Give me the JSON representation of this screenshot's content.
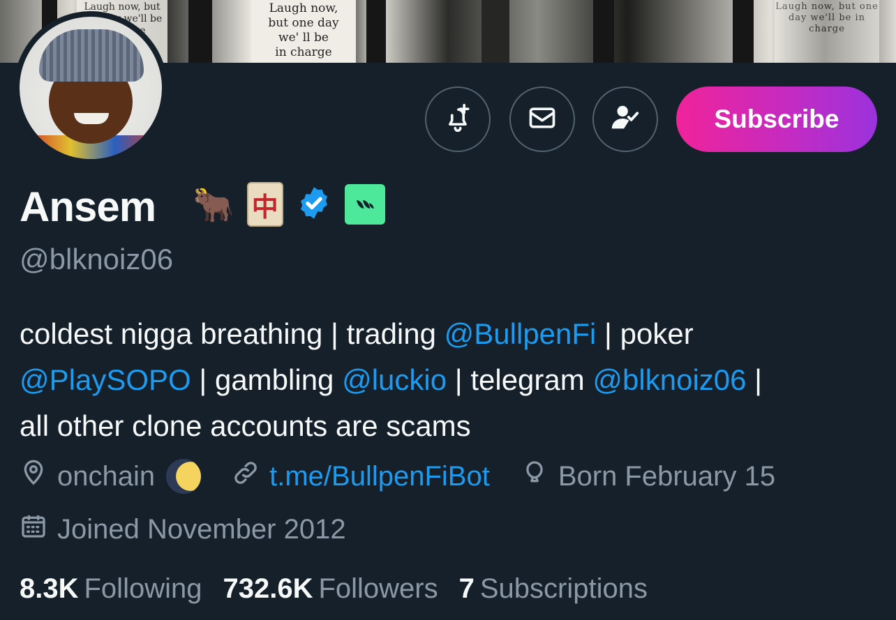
{
  "banner": {
    "poster_text_1": "Laugh now, but one day we'll be in charge",
    "poster_text_2": "Laugh now,\nbut one day\nwe' ll be\nin charge",
    "poster_text_3": "Laugh now, but one day we'll be in charge"
  },
  "profile": {
    "display_name": "Ansem",
    "handle": "@blknoiz06",
    "badges": [
      "ox-emoji-icon",
      "mahjong-tile-icon",
      "verified-badge-icon",
      "affiliate-badge-icon"
    ],
    "mahjong_glyph": "中",
    "ox_glyph": "🐂"
  },
  "actions": {
    "notify_icon": "bell-plus-icon",
    "message_icon": "envelope-icon",
    "following_icon": "person-check-icon",
    "subscribe_label": "Subscribe"
  },
  "bio": {
    "part1": "coldest nigga breathing | trading ",
    "mention1": "@BullpenFi",
    "part2": " | poker ",
    "mention2": "@PlaySOPO",
    "part3": " | gambling ",
    "mention3": "@luckio",
    "part4": " | telegram ",
    "mention4": "@blknoiz06",
    "part5": " |",
    "part6": "all other clone accounts are scams"
  },
  "meta": {
    "location": "onchain",
    "link": "t.me/BullpenFiBot",
    "birthday": "Born February 15",
    "joined": "Joined November 2012"
  },
  "stats": {
    "following_count": "8.3K",
    "following_label": "Following",
    "followers_count": "732.6K",
    "followers_label": "Followers",
    "subscriptions_count": "7",
    "subscriptions_label": "Subscriptions"
  },
  "colors": {
    "background": "#15202b",
    "accent": "#1d9bf0",
    "muted": "#8b98a5",
    "subscribe_gradient_start": "#f0239a",
    "subscribe_gradient_end": "#9b32dd"
  }
}
